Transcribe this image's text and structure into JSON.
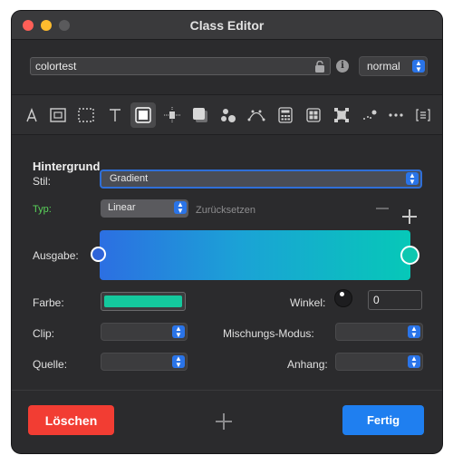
{
  "window": {
    "title": "Class Editor"
  },
  "header": {
    "class_name": "colortest",
    "mode_select": "normal",
    "icons": [
      "lock-icon",
      "info-icon"
    ]
  },
  "toolbar": {
    "tools": [
      "typography-icon",
      "rectangle-icon",
      "dashed-rectangle-icon",
      "text-icon",
      "gradient-fill-icon",
      "align-icon",
      "shadow-icon",
      "shapes-icon",
      "path-icon",
      "calculator-icon",
      "grid-icon",
      "distort-icon",
      "particles-icon",
      "more-icon",
      "list-icon"
    ],
    "active_tool": "gradient-fill-icon"
  },
  "panel": {
    "section_title": "Hintergrund",
    "style_label": "Stil:",
    "style_value": "Gradient",
    "type_label": "Typ:",
    "type_value": "Linear",
    "reset_link": "Zurücksetzen",
    "output_label": "Ausgabe:",
    "color_label": "Farbe:",
    "angle_label": "Winkel:",
    "angle_value": "0",
    "clip_label": "Clip:",
    "blend_label": "Mischungs-Modus:",
    "source_label": "Quelle:",
    "attachment_label": "Anhang:",
    "gradient_colors": [
      "#2c6fe2",
      "#06c8b8"
    ],
    "swatch_color": "#14c99e"
  },
  "footer": {
    "delete_label": "Löschen",
    "done_label": "Fertig"
  },
  "colors": {
    "accent": "#2a74e8",
    "delete": "#f23d33",
    "done": "#1f7ff0",
    "type_label_green": "#5ad35a"
  }
}
